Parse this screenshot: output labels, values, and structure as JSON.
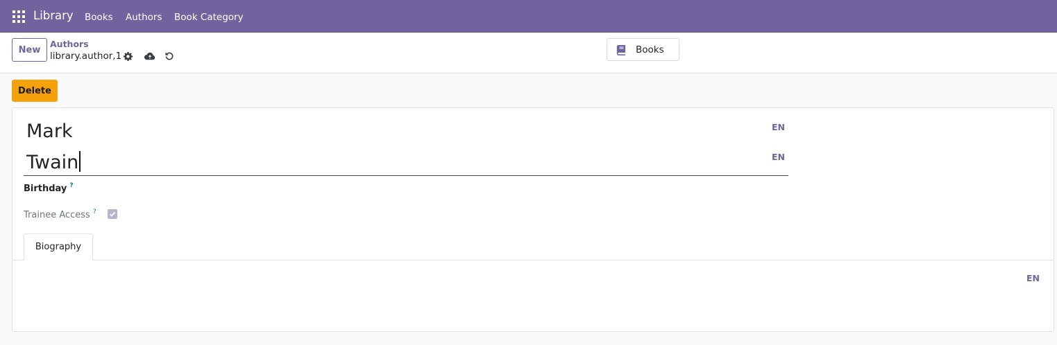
{
  "navbar": {
    "app_name": "Library",
    "menu": [
      "Books",
      "Authors",
      "Book Category"
    ],
    "color": "#71639e"
  },
  "control_panel": {
    "new_label": "New",
    "breadcrumb_parent": "Authors",
    "record_name": "library.author,1",
    "icons": [
      "gear-icon",
      "cloud-upload-icon",
      "discard-icon"
    ],
    "smart_button": {
      "icon": "book-icon",
      "label": "Books"
    }
  },
  "actions": {
    "delete_label": "Delete",
    "delete_color": "#f5a20a"
  },
  "form": {
    "first_name": "Mark",
    "last_name": "Twain",
    "lang": "EN",
    "birthday_label": "Birthday",
    "help_mark": "?",
    "trainee_label": "Trainee Access",
    "trainee_checked": true
  },
  "notebook": {
    "tabs": [
      "Biography"
    ],
    "lang": "EN"
  }
}
